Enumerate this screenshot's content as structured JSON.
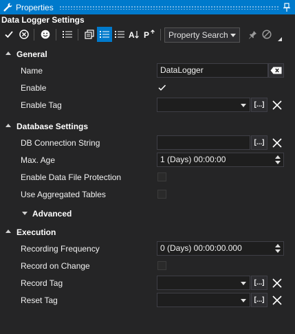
{
  "window": {
    "title": "Properties"
  },
  "subject": {
    "title": "Data Logger Settings"
  },
  "toolbar": {
    "search_label": "Property Search",
    "icons": [
      "checkmark-icon",
      "cancel-circle-icon",
      "smiley-icon",
      "list-icon",
      "pages-icon",
      "categorized-list-icon",
      "alphabetical-list-icon",
      "sort-az-icon",
      "property-pages-icon",
      "pin-icon",
      "disable-icon"
    ]
  },
  "categories": {
    "general": "General",
    "database": "Database Settings",
    "advanced": "Advanced",
    "execution": "Execution"
  },
  "properties": {
    "name": {
      "label": "Name",
      "value": "DataLogger"
    },
    "enable": {
      "label": "Enable",
      "checked": true
    },
    "enable_tag": {
      "label": "Enable Tag",
      "value": ""
    },
    "db_connection": {
      "label": "DB Connection String",
      "value": ""
    },
    "max_age": {
      "label": "Max. Age",
      "value": "1 (Days) 00:00:00"
    },
    "file_protection": {
      "label": "Enable Data File Protection",
      "checked": false
    },
    "aggregated": {
      "label": "Use Aggregated Tables",
      "checked": false
    },
    "recording_frequency": {
      "label": "Recording Frequency",
      "value": "0 (Days) 00:00:00.000"
    },
    "record_on_change": {
      "label": "Record on Change",
      "checked": false
    },
    "record_tag": {
      "label": "Record Tag",
      "value": ""
    },
    "reset_tag": {
      "label": "Reset Tag",
      "value": ""
    }
  },
  "buttons": {
    "browse_label": "[...]"
  },
  "colors": {
    "accent": "#007acc",
    "background": "#252526"
  }
}
